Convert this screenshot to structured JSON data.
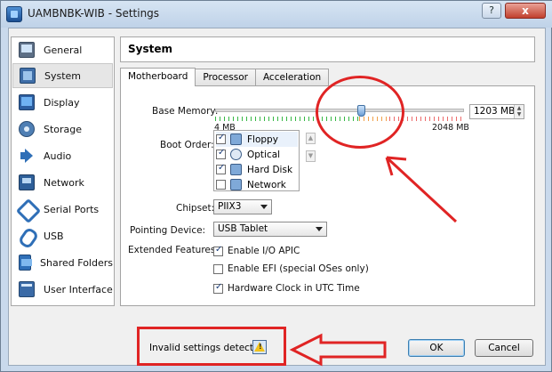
{
  "window": {
    "title": "UAMBNBK-WIB - Settings",
    "help_label": "?",
    "close_label": "x"
  },
  "sidebar": {
    "items": [
      {
        "label": "General",
        "icon": "monitor-icon"
      },
      {
        "label": "System",
        "icon": "chip-icon"
      },
      {
        "label": "Display",
        "icon": "display-icon"
      },
      {
        "label": "Storage",
        "icon": "disk-icon"
      },
      {
        "label": "Audio",
        "icon": "speaker-icon"
      },
      {
        "label": "Network",
        "icon": "network-icon"
      },
      {
        "label": "Serial Ports",
        "icon": "serial-port-icon"
      },
      {
        "label": "USB",
        "icon": "usb-icon"
      },
      {
        "label": "Shared Folders",
        "icon": "folder-icon"
      },
      {
        "label": "User Interface",
        "icon": "window-icon"
      }
    ],
    "selected": "System"
  },
  "header": {
    "title": "System"
  },
  "tabs": {
    "items": [
      "Motherboard",
      "Processor",
      "Acceleration"
    ],
    "active": "Motherboard"
  },
  "motherboard": {
    "base_memory_label": "Base Memory:",
    "memory_min": "4 MB",
    "memory_max": "2048 MB",
    "memory_value": "1203 MB",
    "memory_level": 0.587,
    "boot_order_label": "Boot Order:",
    "boot_items": [
      {
        "label": "Floppy",
        "checked": true
      },
      {
        "label": "Optical",
        "checked": true
      },
      {
        "label": "Hard Disk",
        "checked": true
      },
      {
        "label": "Network",
        "checked": false
      }
    ],
    "chipset_label": "Chipset:",
    "chipset_value": "PIIX3",
    "pointing_label": "Pointing Device:",
    "pointing_value": "USB Tablet",
    "extended_label": "Extended Features:",
    "features": [
      {
        "label": "Enable I/O APIC",
        "checked": true
      },
      {
        "label": "Enable EFI (special OSes only)",
        "checked": false
      },
      {
        "label": "Hardware Clock in UTC Time",
        "checked": true
      }
    ]
  },
  "footer": {
    "status": "Invalid settings detected",
    "ok_label": "OK",
    "cancel_label": "Cancel"
  },
  "colors": {
    "annotation": "#e02424",
    "accent": "#3c7fb1"
  }
}
